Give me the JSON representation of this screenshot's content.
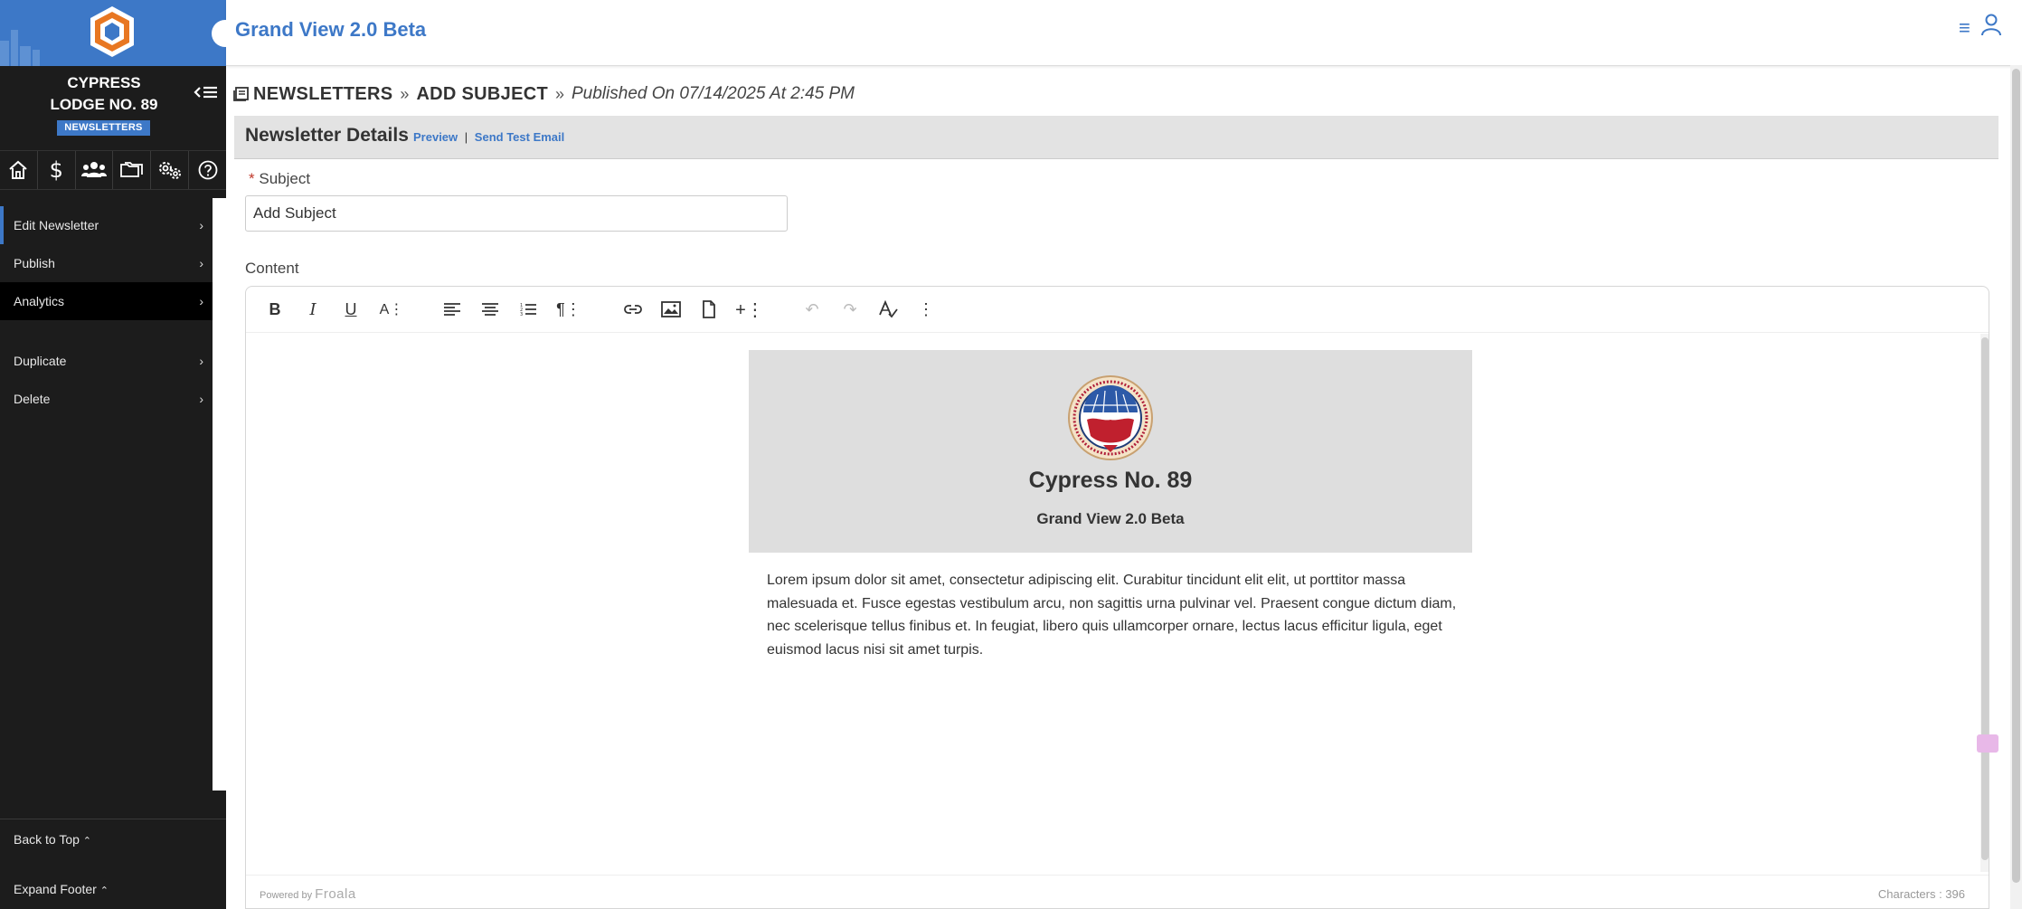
{
  "app": {
    "title": "Grand View 2.0 Beta"
  },
  "sidebar": {
    "lodge_name_line1": "CYPRESS",
    "lodge_name_line2": "LODGE NO. 89",
    "section_badge": "NEWSLETTERS",
    "nav_icons": [
      "home-icon",
      "dollar-icon",
      "members-icon",
      "folders-icon",
      "settings-icon",
      "help-icon"
    ],
    "menu": [
      {
        "label": "Edit Newsletter"
      },
      {
        "label": "Publish"
      },
      {
        "label": "Analytics"
      },
      {
        "label": "Duplicate"
      },
      {
        "label": "Delete"
      }
    ],
    "back_to_top": "Back to Top",
    "expand_footer": "Expand Footer"
  },
  "breadcrumb": {
    "section": "NEWSLETTERS",
    "subject": "ADD SUBJECT",
    "published": "Published On 07/14/2025 At 2:45 PM"
  },
  "details": {
    "title": "Newsletter Details",
    "preview_link": "Preview",
    "separator": "|",
    "send_test_link": "Send Test Email"
  },
  "form": {
    "required_mark": "*",
    "subject_label": "Subject",
    "subject_value": "Add Subject",
    "content_label": "Content"
  },
  "newsletter": {
    "title": "Cypress No. 89",
    "subtitle": "Grand View 2.0 Beta",
    "body": "Lorem ipsum dolor sit amet, consectetur adipiscing elit. Curabitur tincidunt elit elit, ut porttitor massa malesuada et. Fusce egestas vestibulum arcu, non sagittis urna pulvinar vel. Praesent congue dictum diam, nec scelerisque tellus finibus et. In feugiat, libero quis ullamcorper ornare, lectus lacus efficitur ligula, eget euismod lacus nisi sit amet turpis."
  },
  "editor": {
    "powered_by": "Powered by",
    "powered_brand": "Froala",
    "char_count": "Characters : 396"
  },
  "colors": {
    "brand": "#3d78c7",
    "sidebar_bg": "#1c1c1c",
    "header_bg": "#dedede"
  }
}
